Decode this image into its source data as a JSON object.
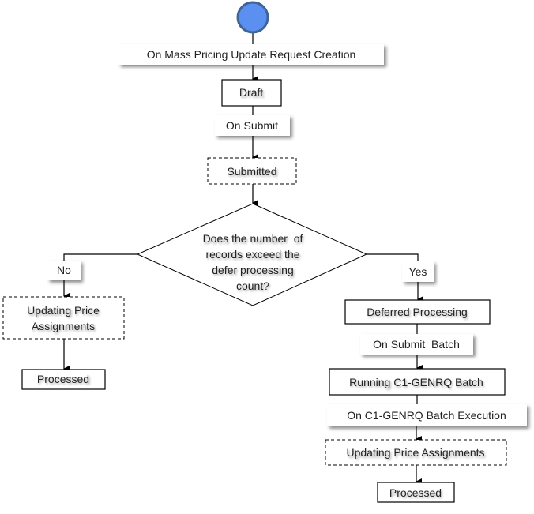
{
  "diagram": {
    "type": "state-flowchart",
    "start_color": "#5b8ff0",
    "start_border_color": "#3f6496",
    "nodes": {
      "start": {
        "kind": "start-circle"
      },
      "trigger_creation": {
        "kind": "transition-label",
        "text": "On Mass Pricing Update Request Creation"
      },
      "draft": {
        "kind": "state",
        "style": "solid",
        "text": "Draft"
      },
      "trigger_submit": {
        "kind": "transition-label",
        "text": "On Submit"
      },
      "submitted": {
        "kind": "state",
        "style": "dashed",
        "text": "Submitted"
      },
      "decision": {
        "kind": "decision",
        "lines": [
          "Does the number  of",
          "records exceed the",
          "defer processing",
          "count?"
        ]
      },
      "label_no": {
        "kind": "branch-label",
        "text": "No"
      },
      "label_yes": {
        "kind": "branch-label",
        "text": "Yes"
      },
      "left_updating": {
        "kind": "state",
        "style": "dashed",
        "lines": [
          "Updating Price",
          "Assignments"
        ]
      },
      "left_processed": {
        "kind": "state",
        "style": "solid",
        "text": "Processed"
      },
      "deferred": {
        "kind": "state",
        "style": "solid",
        "text": "Deferred Processing"
      },
      "trigger_submit_batch": {
        "kind": "transition-label",
        "text": "On Submit  Batch"
      },
      "running_batch": {
        "kind": "state",
        "style": "solid",
        "text": "Running C1-GENRQ Batch"
      },
      "trigger_batch_exec": {
        "kind": "transition-label",
        "text": "On C1-GENRQ Batch Execution"
      },
      "right_updating": {
        "kind": "state",
        "style": "dashed",
        "text": "Updating Price Assignments"
      },
      "right_processed": {
        "kind": "state",
        "style": "solid",
        "text": "Processed"
      }
    },
    "edges": [
      [
        "start",
        "trigger_creation",
        "draft"
      ],
      [
        "draft",
        "trigger_submit",
        "submitted"
      ],
      [
        "submitted",
        "decision"
      ],
      [
        "decision",
        "label_no",
        "left_updating"
      ],
      [
        "left_updating",
        "left_processed"
      ],
      [
        "decision",
        "label_yes",
        "deferred"
      ],
      [
        "deferred",
        "trigger_submit_batch",
        "running_batch"
      ],
      [
        "running_batch",
        "trigger_batch_exec",
        "right_updating"
      ],
      [
        "right_updating",
        "right_processed"
      ]
    ]
  }
}
